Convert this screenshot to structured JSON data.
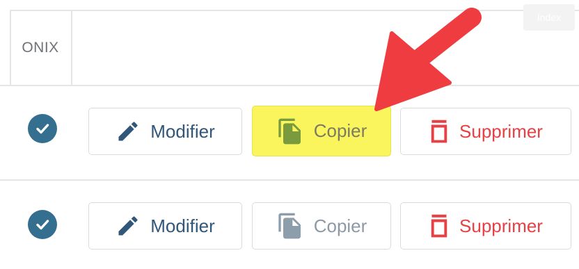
{
  "header": {
    "column_title": "ONIX",
    "index_badge": "Index"
  },
  "rows": [
    {
      "status_icon": "check-circle-icon",
      "modify_label": "Modifier",
      "copy_label": "Copier",
      "delete_label": "Supprimer",
      "copy_highlighted": true
    },
    {
      "status_icon": "check-circle-icon",
      "modify_label": "Modifier",
      "copy_label": "Copier",
      "delete_label": "Supprimer",
      "copy_highlighted": false
    }
  ],
  "colors": {
    "highlight": "#faf55c",
    "arrow": "#ee3c41",
    "check": "#356f8f",
    "modify": "#30577a",
    "delete": "#e64145",
    "copy_icon_highlighted": "#7a9a3e",
    "copy_icon_default": "#8d9eab"
  }
}
